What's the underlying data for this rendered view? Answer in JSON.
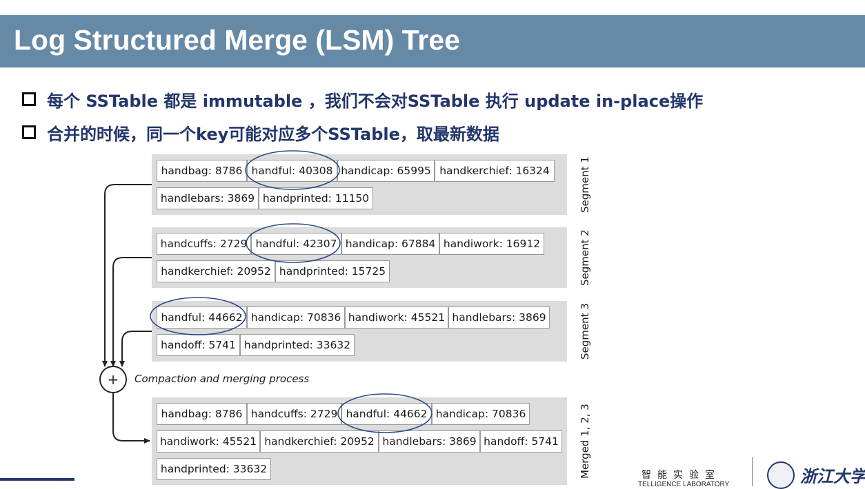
{
  "slide": {
    "title": "Log Structured Merge (LSM) Tree",
    "bullets": [
      "每个 SSTable 都是 immutable ，我们不会对SSTable 执行 update in-place操作",
      "合并的时候，同一个key可能对应多个SSTable，取最新数据"
    ]
  },
  "diagram": {
    "segments": [
      {
        "label": "Segment 1",
        "rows": [
          [
            "handbag: 8786",
            "handful: 40308",
            "handicap: 65995",
            "handkerchief: 16324"
          ],
          [
            "handlebars: 3869",
            "handprinted: 11150"
          ]
        ]
      },
      {
        "label": "Segment 2",
        "rows": [
          [
            "handcuffs: 2729",
            "handful: 42307",
            "handicap: 67884",
            "handiwork: 16912"
          ],
          [
            "handkerchief: 20952",
            "handprinted: 15725"
          ]
        ]
      },
      {
        "label": "Segment 3",
        "rows": [
          [
            "handful: 44662",
            "handicap: 70836",
            "handiwork: 45521",
            "handlebars: 3869"
          ],
          [
            "handoff: 5741",
            "handprinted: 33632"
          ]
        ]
      },
      {
        "label": "Merged 1, 2, 3",
        "rows": [
          [
            "handbag: 8786",
            "handcuffs: 2729",
            "handful: 44662",
            "handicap: 70836"
          ],
          [
            "handiwork: 45521",
            "handkerchief: 20952",
            "handlebars: 3869",
            "handoff: 5741"
          ],
          [
            "handprinted: 33632"
          ]
        ]
      }
    ],
    "process_label": "Compaction and merging process",
    "plus_symbol": "+",
    "circle_color": "#2a4a86"
  },
  "footer": {
    "lab_name_cn": "智能实验室",
    "lab_name_en": "TELLIGENCE LABORATORY",
    "university_cn": "浙江大学"
  },
  "colors": {
    "title_bar": "#6689a6",
    "bullet_text": "#23366b",
    "segment_bg": "#dcdcdc"
  }
}
